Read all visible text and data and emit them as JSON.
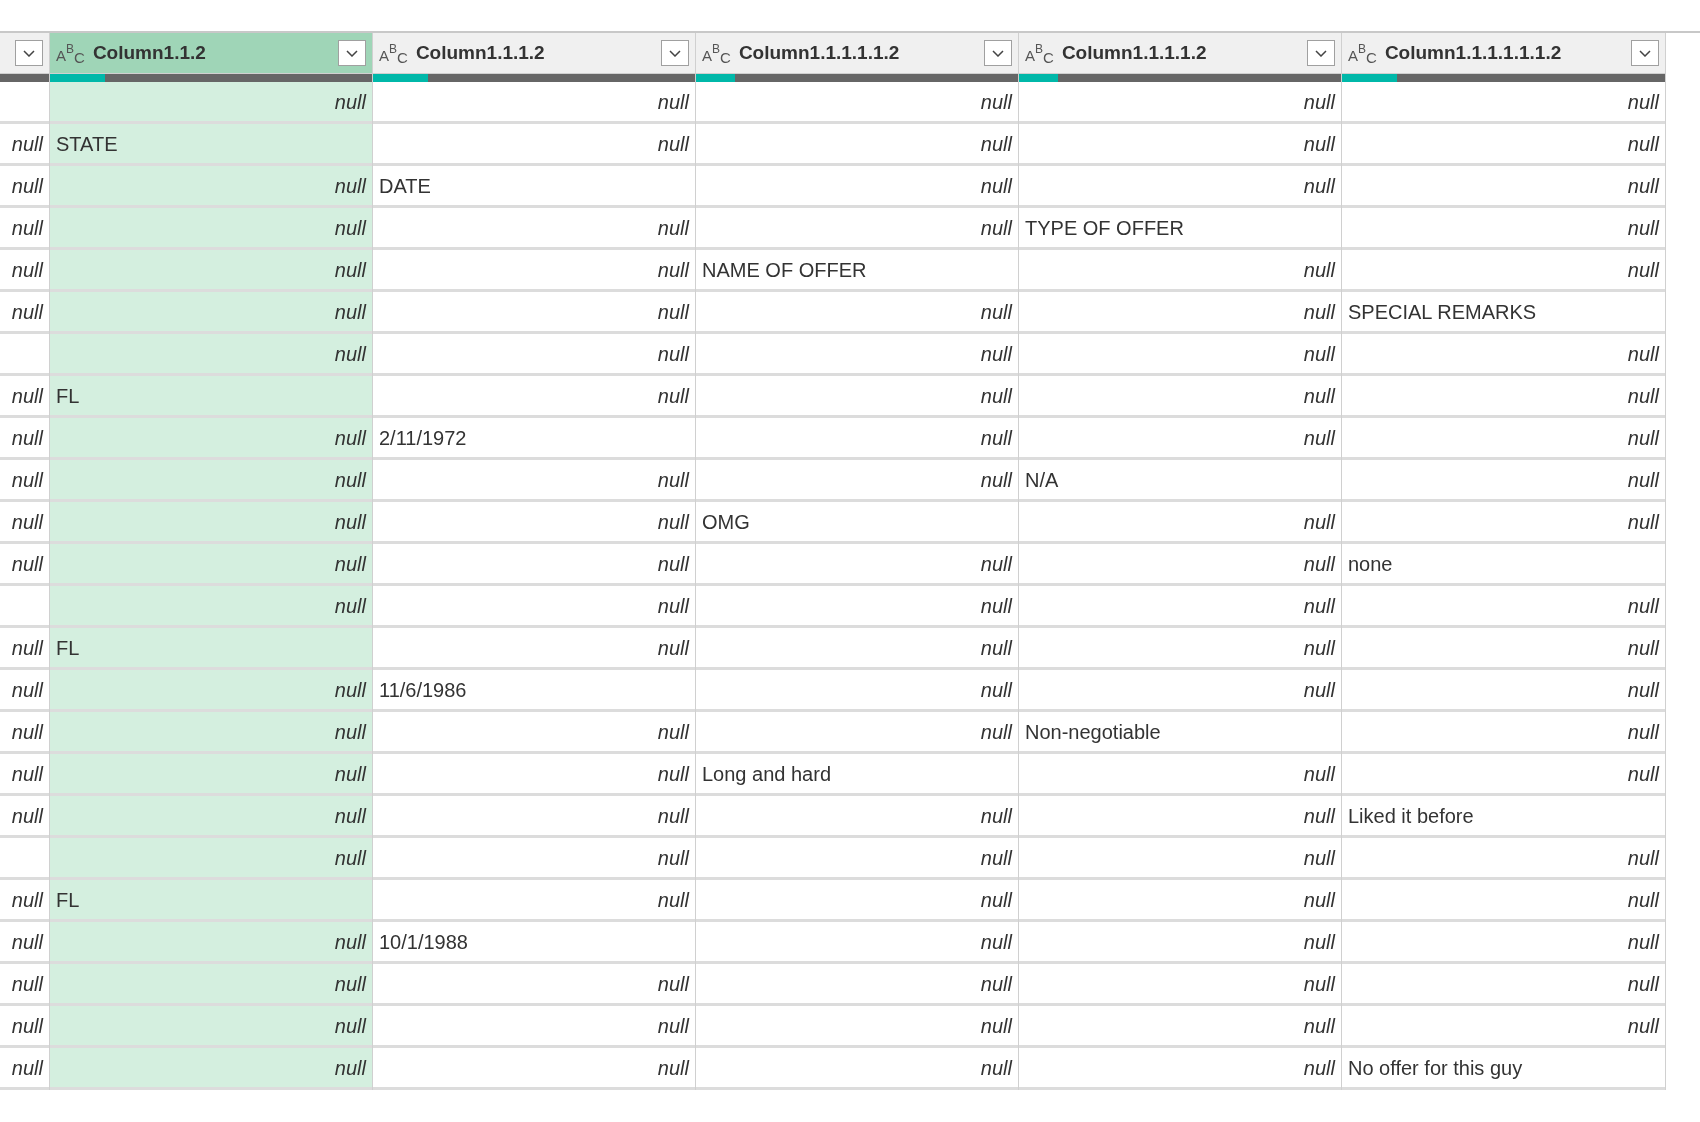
{
  "columns": [
    {
      "selected": false
    },
    {
      "label": "Column1.1.2",
      "type_label": "ABC",
      "selected": true,
      "level": 0.17
    },
    {
      "label": "Column1.1.1.2",
      "type_label": "ABC",
      "selected": false,
      "level": 0.17
    },
    {
      "label": "Column1.1.1.1.1.2",
      "type_label": "ABC",
      "selected": false,
      "level": 0.12
    },
    {
      "label": "Column1.1.1.1.2",
      "type_label": "ABC",
      "selected": false,
      "level": 0.12
    },
    {
      "label": "Column1.1.1.1.1.1.2",
      "type_label": "ABC",
      "selected": false,
      "level": 0.17
    }
  ],
  "rows": [
    [
      null,
      {
        "kind": "null",
        "text": "null"
      },
      {
        "kind": "null",
        "text": "null"
      },
      {
        "kind": "null",
        "text": "null"
      },
      {
        "kind": "null",
        "text": "null"
      },
      {
        "kind": "null",
        "text": "null"
      }
    ],
    [
      {
        "kind": "null",
        "text": "null"
      },
      {
        "kind": "text",
        "text": "STATE"
      },
      {
        "kind": "null",
        "text": "null"
      },
      {
        "kind": "null",
        "text": "null"
      },
      {
        "kind": "null",
        "text": "null"
      },
      {
        "kind": "null",
        "text": "null"
      }
    ],
    [
      {
        "kind": "null",
        "text": "null"
      },
      {
        "kind": "null",
        "text": "null"
      },
      {
        "kind": "text",
        "text": "DATE"
      },
      {
        "kind": "null",
        "text": "null"
      },
      {
        "kind": "null",
        "text": "null"
      },
      {
        "kind": "null",
        "text": "null"
      }
    ],
    [
      {
        "kind": "null",
        "text": "null"
      },
      {
        "kind": "null",
        "text": "null"
      },
      {
        "kind": "null",
        "text": "null"
      },
      {
        "kind": "null",
        "text": "null"
      },
      {
        "kind": "text",
        "text": "TYPE OF OFFER"
      },
      {
        "kind": "null",
        "text": "null"
      }
    ],
    [
      {
        "kind": "null",
        "text": "null"
      },
      {
        "kind": "null",
        "text": "null"
      },
      {
        "kind": "null",
        "text": "null"
      },
      {
        "kind": "text",
        "text": "NAME OF OFFER"
      },
      {
        "kind": "null",
        "text": "null"
      },
      {
        "kind": "null",
        "text": "null"
      }
    ],
    [
      {
        "kind": "null",
        "text": "null"
      },
      {
        "kind": "null",
        "text": "null"
      },
      {
        "kind": "null",
        "text": "null"
      },
      {
        "kind": "null",
        "text": "null"
      },
      {
        "kind": "null",
        "text": "null"
      },
      {
        "kind": "text",
        "text": "SPECIAL REMARKS"
      }
    ],
    [
      null,
      {
        "kind": "null",
        "text": "null"
      },
      {
        "kind": "null",
        "text": "null"
      },
      {
        "kind": "null",
        "text": "null"
      },
      {
        "kind": "null",
        "text": "null"
      },
      {
        "kind": "null",
        "text": "null"
      }
    ],
    [
      {
        "kind": "null",
        "text": "null"
      },
      {
        "kind": "text",
        "text": "FL"
      },
      {
        "kind": "null",
        "text": "null"
      },
      {
        "kind": "null",
        "text": "null"
      },
      {
        "kind": "null",
        "text": "null"
      },
      {
        "kind": "null",
        "text": "null"
      }
    ],
    [
      {
        "kind": "null",
        "text": "null"
      },
      {
        "kind": "null",
        "text": "null"
      },
      {
        "kind": "text",
        "text": "2/11/1972"
      },
      {
        "kind": "null",
        "text": "null"
      },
      {
        "kind": "null",
        "text": "null"
      },
      {
        "kind": "null",
        "text": "null"
      }
    ],
    [
      {
        "kind": "null",
        "text": "null"
      },
      {
        "kind": "null",
        "text": "null"
      },
      {
        "kind": "null",
        "text": "null"
      },
      {
        "kind": "null",
        "text": "null"
      },
      {
        "kind": "text",
        "text": "N/A"
      },
      {
        "kind": "null",
        "text": "null"
      }
    ],
    [
      {
        "kind": "null",
        "text": "null"
      },
      {
        "kind": "null",
        "text": "null"
      },
      {
        "kind": "null",
        "text": "null"
      },
      {
        "kind": "text",
        "text": "OMG"
      },
      {
        "kind": "null",
        "text": "null"
      },
      {
        "kind": "null",
        "text": "null"
      }
    ],
    [
      {
        "kind": "null",
        "text": "null"
      },
      {
        "kind": "null",
        "text": "null"
      },
      {
        "kind": "null",
        "text": "null"
      },
      {
        "kind": "null",
        "text": "null"
      },
      {
        "kind": "null",
        "text": "null"
      },
      {
        "kind": "text",
        "text": "none"
      }
    ],
    [
      null,
      {
        "kind": "null",
        "text": "null"
      },
      {
        "kind": "null",
        "text": "null"
      },
      {
        "kind": "null",
        "text": "null"
      },
      {
        "kind": "null",
        "text": "null"
      },
      {
        "kind": "null",
        "text": "null"
      }
    ],
    [
      {
        "kind": "null",
        "text": "null"
      },
      {
        "kind": "text",
        "text": "FL"
      },
      {
        "kind": "null",
        "text": "null"
      },
      {
        "kind": "null",
        "text": "null"
      },
      {
        "kind": "null",
        "text": "null"
      },
      {
        "kind": "null",
        "text": "null"
      }
    ],
    [
      {
        "kind": "null",
        "text": "null"
      },
      {
        "kind": "null",
        "text": "null"
      },
      {
        "kind": "text",
        "text": "11/6/1986"
      },
      {
        "kind": "null",
        "text": "null"
      },
      {
        "kind": "null",
        "text": "null"
      },
      {
        "kind": "null",
        "text": "null"
      }
    ],
    [
      {
        "kind": "null",
        "text": "null"
      },
      {
        "kind": "null",
        "text": "null"
      },
      {
        "kind": "null",
        "text": "null"
      },
      {
        "kind": "null",
        "text": "null"
      },
      {
        "kind": "text",
        "text": "Non-negotiable"
      },
      {
        "kind": "null",
        "text": "null"
      }
    ],
    [
      {
        "kind": "null",
        "text": "null"
      },
      {
        "kind": "null",
        "text": "null"
      },
      {
        "kind": "null",
        "text": "null"
      },
      {
        "kind": "text",
        "text": "Long and hard"
      },
      {
        "kind": "null",
        "text": "null"
      },
      {
        "kind": "null",
        "text": "null"
      }
    ],
    [
      {
        "kind": "null",
        "text": "null"
      },
      {
        "kind": "null",
        "text": "null"
      },
      {
        "kind": "null",
        "text": "null"
      },
      {
        "kind": "null",
        "text": "null"
      },
      {
        "kind": "null",
        "text": "null"
      },
      {
        "kind": "text",
        "text": "Liked it before"
      }
    ],
    [
      null,
      {
        "kind": "null",
        "text": "null"
      },
      {
        "kind": "null",
        "text": "null"
      },
      {
        "kind": "null",
        "text": "null"
      },
      {
        "kind": "null",
        "text": "null"
      },
      {
        "kind": "null",
        "text": "null"
      }
    ],
    [
      {
        "kind": "null",
        "text": "null"
      },
      {
        "kind": "text",
        "text": "FL"
      },
      {
        "kind": "null",
        "text": "null"
      },
      {
        "kind": "null",
        "text": "null"
      },
      {
        "kind": "null",
        "text": "null"
      },
      {
        "kind": "null",
        "text": "null"
      }
    ],
    [
      {
        "kind": "null",
        "text": "null"
      },
      {
        "kind": "null",
        "text": "null"
      },
      {
        "kind": "text",
        "text": "10/1/1988"
      },
      {
        "kind": "null",
        "text": "null"
      },
      {
        "kind": "null",
        "text": "null"
      },
      {
        "kind": "null",
        "text": "null"
      }
    ],
    [
      {
        "kind": "null",
        "text": "null"
      },
      {
        "kind": "null",
        "text": "null"
      },
      {
        "kind": "null",
        "text": "null"
      },
      {
        "kind": "null",
        "text": "null"
      },
      {
        "kind": "null",
        "text": "null"
      },
      {
        "kind": "null",
        "text": "null"
      }
    ],
    [
      {
        "kind": "null",
        "text": "null"
      },
      {
        "kind": "null",
        "text": "null"
      },
      {
        "kind": "null",
        "text": "null"
      },
      {
        "kind": "null",
        "text": "null"
      },
      {
        "kind": "null",
        "text": "null"
      },
      {
        "kind": "null",
        "text": "null"
      }
    ],
    [
      {
        "kind": "null",
        "text": "null"
      },
      {
        "kind": "null",
        "text": "null"
      },
      {
        "kind": "null",
        "text": "null"
      },
      {
        "kind": "null",
        "text": "null"
      },
      {
        "kind": "null",
        "text": "null"
      },
      {
        "kind": "text",
        "text": "No offer for this guy"
      }
    ]
  ]
}
